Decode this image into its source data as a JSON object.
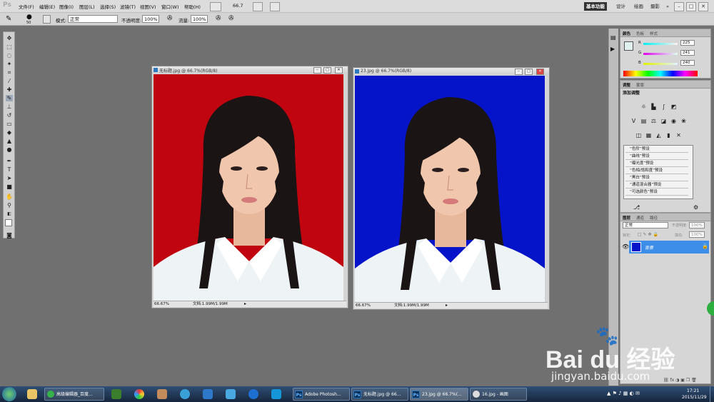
{
  "app": {
    "logo": "Ps",
    "menu": [
      "文件(F)",
      "编辑(E)",
      "图像(I)",
      "图层(L)",
      "选择(S)",
      "滤镜(T)",
      "视图(V)",
      "窗口(W)",
      "帮助(H)"
    ],
    "zoom_readout": "66.7",
    "workspaces": [
      "基本功能",
      "设计",
      "绘画",
      "摄影"
    ],
    "workspace_more": "»",
    "window_controls": [
      "–",
      "□",
      "✕"
    ]
  },
  "options": {
    "brush_size": "50",
    "mode_label": "模式:",
    "mode_value": "正常",
    "opacity_label": "不透明度:",
    "opacity_value": "100%",
    "flow_label": "流量:",
    "flow_value": "100%"
  },
  "documents": [
    {
      "title": "无标题.jpg @ 66.7%(RGB/8)",
      "zoom": "66.67%",
      "doc_info": "文档:1.99M/1.99M",
      "background": "#c00510"
    },
    {
      "title": "23.jpg @ 66.7%(RGB/8)",
      "zoom": "66.67%",
      "doc_info": "文档:1.99M/1.99M",
      "background": "#0514c8"
    }
  ],
  "color_panel": {
    "tabs": [
      "颜色",
      "色板",
      "样式"
    ],
    "r_label": "R",
    "r_value": "225",
    "g_label": "G",
    "g_value": "241",
    "b_label": "B",
    "b_value": "240"
  },
  "adjust_panel": {
    "tabs": [
      "调整",
      "蒙版"
    ],
    "heading": "添加调整",
    "presets": [
      "“色阶”预设",
      "“曲线”预设",
      "“曝光度”预设",
      "“色相/饱和度”预设",
      "“黑白”预设",
      "“通道混合器”预设",
      "“可选颜色”预设"
    ]
  },
  "layers_panel": {
    "tabs": [
      "图层",
      "通道",
      "路径"
    ],
    "blend_mode": "正常",
    "opacity_label": "不透明度:",
    "opacity_value": "100%",
    "lock_label": "锁定:",
    "fill_label": "填充:",
    "fill_value": "100%",
    "layer_name": "背景"
  },
  "taskbar": {
    "items": [
      "高级编辑器_百度...",
      "Adobe Photosh...",
      "无标题.jpg @ 66...",
      "23.jpg @ 66.7%(...",
      "16.jpg - 画图"
    ],
    "time": "17:21",
    "date": "2015/11/29"
  },
  "watermark": {
    "brand": "Bai du 经验",
    "url": "jingyan.baidu.com"
  },
  "colors": {
    "accent_layer": "#3d8ee8",
    "workspace_active_bg": "#333333",
    "canvas_bg": "#707070",
    "shirt": "#eef4f6",
    "skin": "#f0c6ad",
    "hair": "#1a1414"
  }
}
